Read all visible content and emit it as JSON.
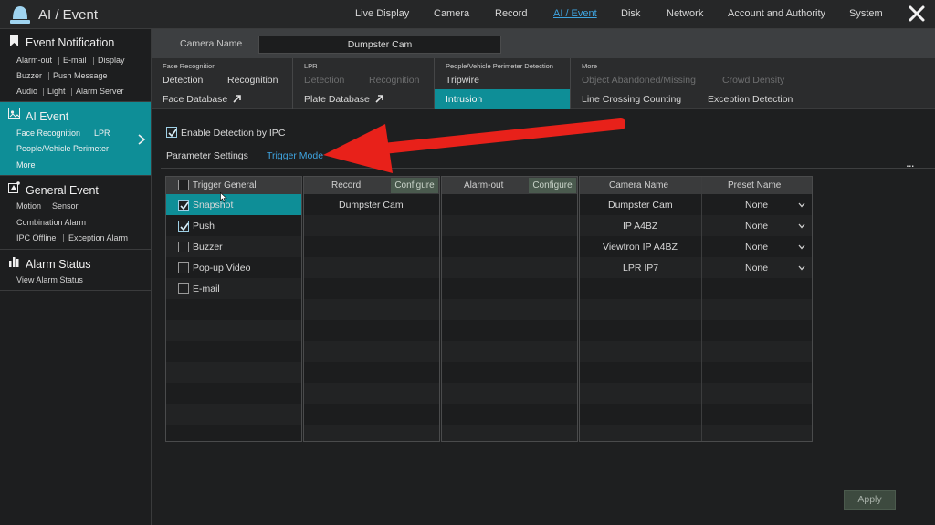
{
  "app": {
    "title": "AI / Event",
    "icon": "alarm-light-icon"
  },
  "nav": [
    "Live Display",
    "Camera",
    "Record",
    "AI / Event",
    "Disk",
    "Network",
    "Account and Authority",
    "System"
  ],
  "nav_active": "AI / Event",
  "sidebar": {
    "event_notification": {
      "title": "Event Notification",
      "icon": "bookmark-icon",
      "items": [
        "Alarm-out",
        "E-mail",
        "Display",
        "Buzzer",
        "Push Message",
        "Audio",
        "Light",
        "Alarm Server"
      ]
    },
    "ai_event": {
      "title": "AI Event",
      "icon": "ai-icon",
      "items": [
        "Face Recognition",
        "LPR",
        "People/Vehicle Perimeter",
        "More"
      ]
    },
    "general_event": {
      "title": "General Event",
      "icon": "event-icon",
      "items": [
        "Motion",
        "Sensor",
        "Combination Alarm",
        "IPC Offline",
        "Exception Alarm"
      ]
    },
    "alarm_status": {
      "title": "Alarm Status",
      "icon": "status-icon",
      "items": [
        "View Alarm Status"
      ]
    }
  },
  "camera": {
    "label": "Camera Name",
    "value": "Dumpster Cam"
  },
  "categories": {
    "face": {
      "header": "Face Recognition",
      "detection": "Detection",
      "recognition": "Recognition",
      "database": "Face Database"
    },
    "lpr": {
      "header": "LPR",
      "detection": "Detection",
      "recognition": "Recognition",
      "database": "Plate Database"
    },
    "perimeter": {
      "header": "People/Vehicle Perimeter Detection",
      "tripwire": "Tripwire",
      "intrusion": "Intrusion"
    },
    "more": {
      "header": "More",
      "object": "Object Abandoned/Missing",
      "crowd": "Crowd Density",
      "line": "Line Crossing Counting",
      "exception": "Exception Detection"
    }
  },
  "enable_detection": {
    "label": "Enable Detection by IPC",
    "checked": true
  },
  "tabs": [
    "Parameter Settings",
    "Trigger Mode"
  ],
  "tab_active": "Trigger Mode",
  "trigger": {
    "header": "Trigger General",
    "items": [
      {
        "label": "Snapshot",
        "checked": true
      },
      {
        "label": "Push",
        "checked": true
      },
      {
        "label": "Buzzer",
        "checked": false
      },
      {
        "label": "Pop-up Video",
        "checked": false
      },
      {
        "label": "E-mail",
        "checked": false
      }
    ]
  },
  "record": {
    "header": "Record",
    "configure": "Configure",
    "rows": [
      "Dumpster Cam"
    ]
  },
  "alarm_out": {
    "header": "Alarm-out",
    "configure": "Configure"
  },
  "preset": {
    "col_camera": "Camera Name",
    "col_preset": "Preset Name",
    "rows": [
      {
        "camera": "Dumpster Cam",
        "preset": "None"
      },
      {
        "camera": "IP A4BZ",
        "preset": "None"
      },
      {
        "camera": "Viewtron IP A4BZ",
        "preset": "None"
      },
      {
        "camera": "LPR IP7",
        "preset": "None"
      }
    ]
  },
  "more_menu": "...",
  "apply": "Apply",
  "colors": {
    "accent": "#0e8e97",
    "link": "#3fa4e0",
    "arrow": "#e8211a"
  }
}
